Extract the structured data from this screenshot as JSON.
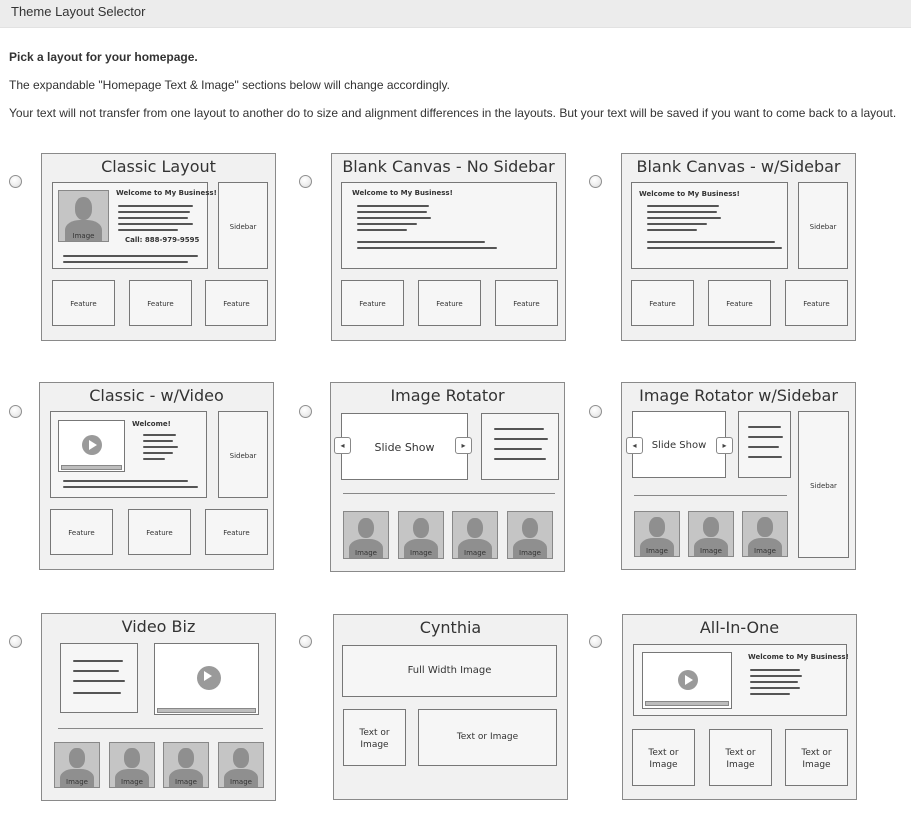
{
  "header": {
    "title": "Theme Layout Selector"
  },
  "intro": {
    "heading": "Pick a layout for your homepage.",
    "line2": "The expandable \"Homepage Text & Image\" sections below will change accordingly.",
    "line3": "Your text will not transfer from one layout to another do to size and alignment differences in the layouts. But your text will be saved if you want to come back to a layout."
  },
  "layouts": [
    {
      "name": "Classic Layout",
      "welcome": "Welcome to My Business!",
      "image": "Image",
      "call": "Call: 888-979-9595",
      "sidebar": "Sidebar",
      "features": [
        "Feature",
        "Feature",
        "Feature"
      ]
    },
    {
      "name": "Blank Canvas - No Sidebar",
      "welcome": "Welcome to My Business!",
      "features": [
        "Feature",
        "Feature",
        "Feature"
      ]
    },
    {
      "name": "Blank Canvas - w/Sidebar",
      "welcome": "Welcome to My Business!",
      "sidebar": "Sidebar",
      "features": [
        "Feature",
        "Feature",
        "Feature"
      ]
    },
    {
      "name": "Classic - w/Video",
      "welcome": "Welcome!",
      "sidebar": "Sidebar",
      "features": [
        "Feature",
        "Feature",
        "Feature"
      ]
    },
    {
      "name": "Image Rotator",
      "slideshow": "Slide Show",
      "images": [
        "Image",
        "Image",
        "Image",
        "Image"
      ]
    },
    {
      "name": "Image Rotator w/Sidebar",
      "slideshow": "Slide Show",
      "sidebar": "Sidebar",
      "images": [
        "Image",
        "Image",
        "Image"
      ]
    },
    {
      "name": "Video Biz",
      "images": [
        "Image",
        "Image",
        "Image",
        "Image"
      ]
    },
    {
      "name": "Cynthia",
      "fullwidth": "Full Width Image",
      "text_or_image": [
        "Text or Image",
        "Text or Image"
      ]
    },
    {
      "name": "All-In-One",
      "welcome": "Welcome to My Business!",
      "text_or_image": [
        "Text or Image",
        "Text or Image",
        "Text or Image"
      ]
    }
  ],
  "selected": null
}
